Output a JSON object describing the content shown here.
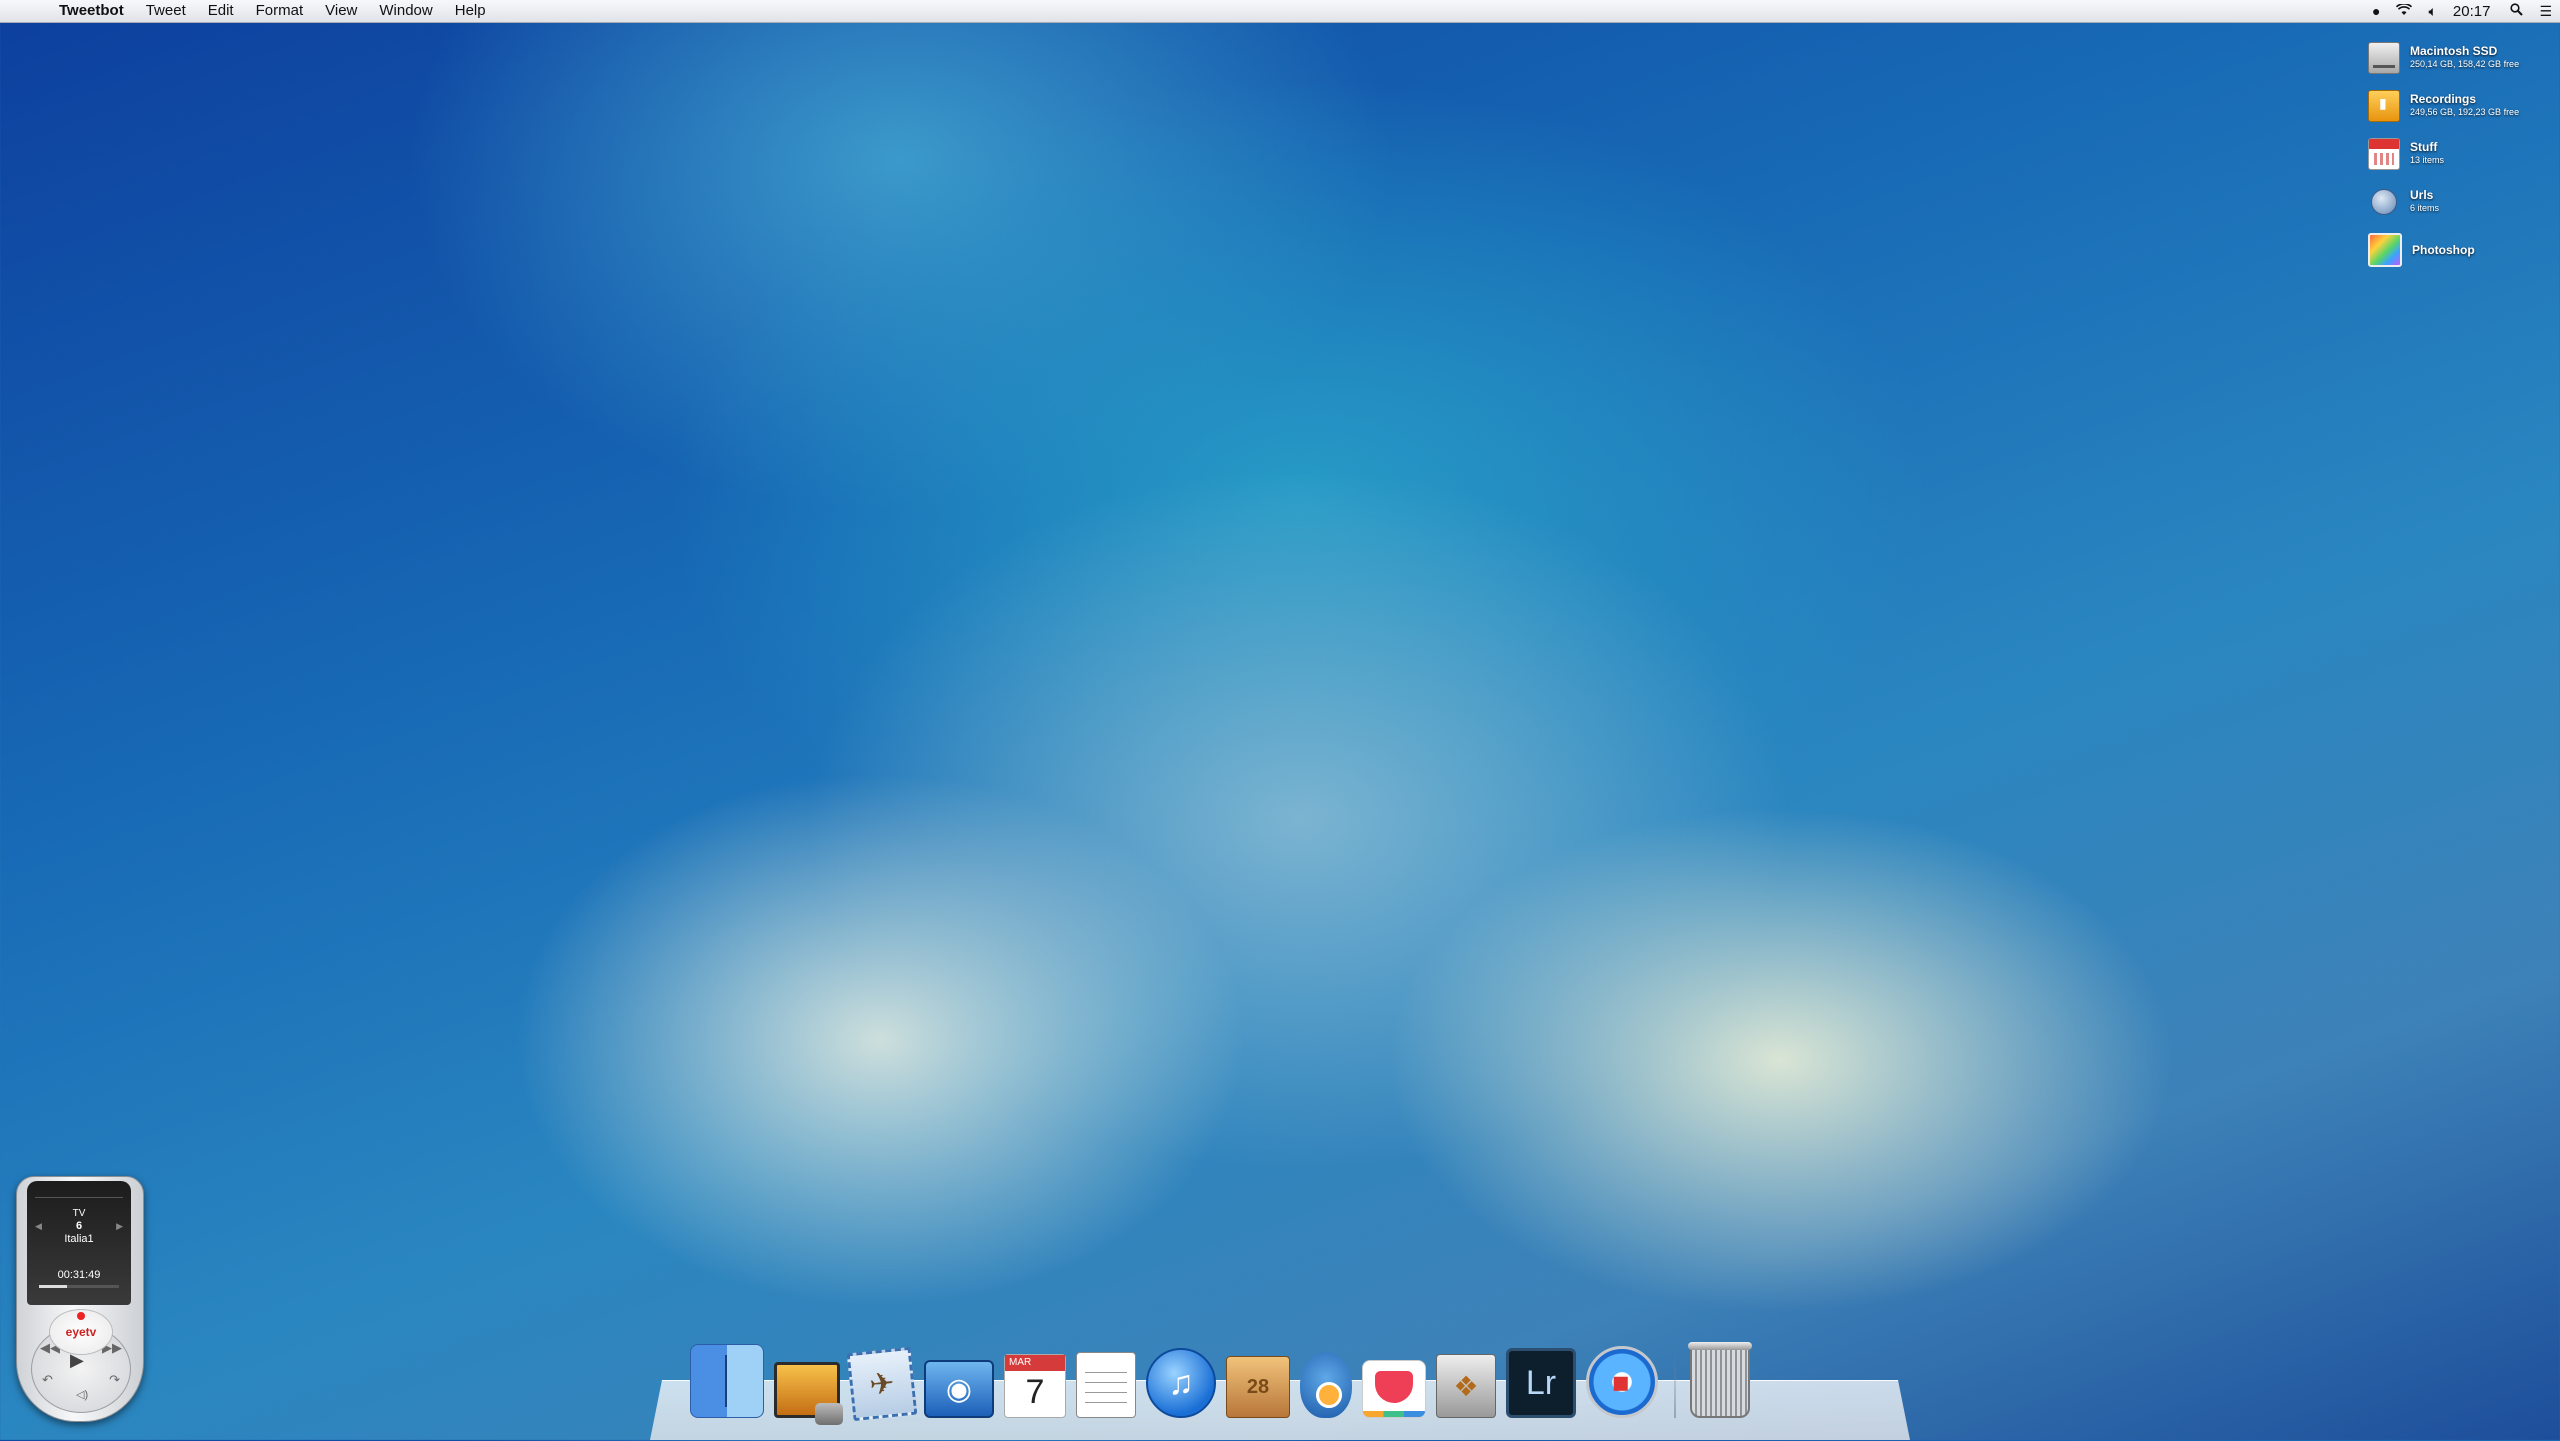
{
  "menubar": {
    "app_name": "Tweetbot",
    "menus": [
      "Tweet",
      "Edit",
      "Format",
      "View",
      "Window",
      "Help"
    ],
    "clock": "20:17",
    "status_icons": [
      "tweetbot-status-icon",
      "wifi-icon",
      "volume-icon",
      "spotlight-icon",
      "notification-center-icon"
    ]
  },
  "desktop": {
    "items": [
      {
        "name": "Macintosh SSD",
        "sub": "250,14 GB, 158,42 GB free",
        "icon": "hard-drive-icon"
      },
      {
        "name": "Recordings",
        "sub": "249,56 GB, 192,23 GB free",
        "icon": "external-drive-icon"
      },
      {
        "name": "Stuff",
        "sub": "13 items",
        "icon": "stack-icon"
      },
      {
        "name": "Urls",
        "sub": "6 items",
        "icon": "globe-icon"
      },
      {
        "name": "Photoshop",
        "sub": "",
        "icon": "photoshop-alias-icon"
      }
    ]
  },
  "remote": {
    "mode": "TV",
    "channel": "6",
    "channel_name": "Italia1",
    "time": "00:31:49",
    "progress": 0.35,
    "logo": "eyetv"
  },
  "dock": {
    "apps": [
      {
        "name": "finder-icon"
      },
      {
        "name": "iphoto-icon"
      },
      {
        "name": "mail-icon"
      },
      {
        "name": "preview-icon"
      },
      {
        "name": "calendar-icon",
        "month": "MAR",
        "day": "7"
      },
      {
        "name": "reminders-icon"
      },
      {
        "name": "itunes-icon"
      },
      {
        "name": "deliveries-icon",
        "badge": "28"
      },
      {
        "name": "tweetbot-icon"
      },
      {
        "name": "pocket-icon"
      },
      {
        "name": "keka-icon"
      },
      {
        "name": "lightroom-icon",
        "text": "Lr"
      },
      {
        "name": "safari-icon"
      },
      {
        "name": "trash-icon"
      }
    ]
  }
}
